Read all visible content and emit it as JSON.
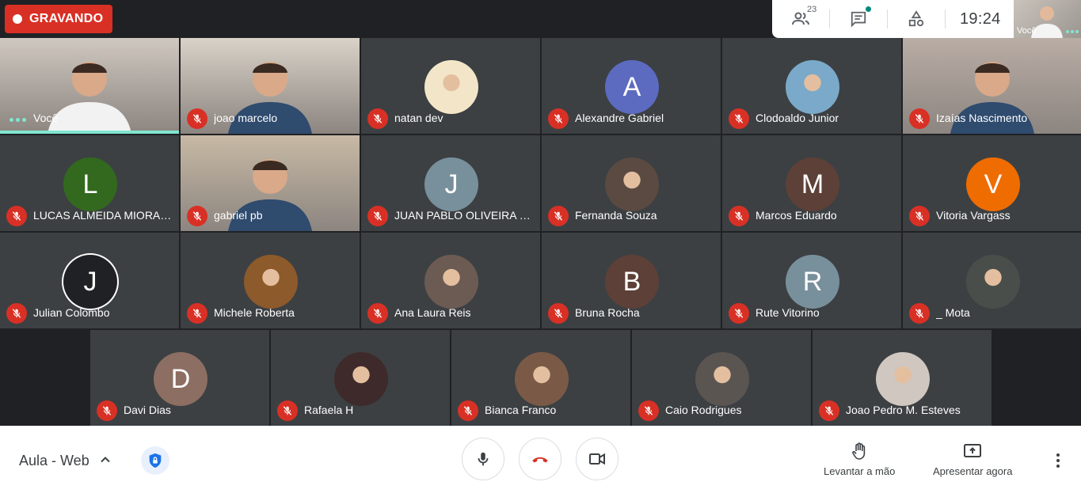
{
  "recording": {
    "label": "GRAVANDO"
  },
  "topbar": {
    "participants_count": "23",
    "clock": "19:24",
    "self_thumb_label": "Você"
  },
  "rows": [
    [
      {
        "name": "Você",
        "kind": "video-self"
      },
      {
        "name": "joao marcelo",
        "kind": "video",
        "bg": "#d8d2c8"
      },
      {
        "name": "natan dev",
        "kind": "photo",
        "color": "#f3e6c8"
      },
      {
        "name": "Alexandre Gabriel",
        "kind": "letter",
        "letter": "A",
        "color": "#5c6bc0"
      },
      {
        "name": "Clodoaldo Junior",
        "kind": "photo",
        "color": "#7aa9c9"
      },
      {
        "name": "Izaías Nascimento",
        "kind": "video",
        "bg": "#b9ada5"
      }
    ],
    [
      {
        "name": "LUCAS ALMEIDA MIORANSI",
        "kind": "letter",
        "letter": "L",
        "color": "#33691e"
      },
      {
        "name": "gabriel pb",
        "kind": "video",
        "bg": "#c7b9a4"
      },
      {
        "name": "JUAN PABLO OLIVEIRA G...",
        "kind": "letter",
        "letter": "J",
        "color": "#78909c"
      },
      {
        "name": "Fernanda Souza",
        "kind": "photo",
        "color": "#5a4a42"
      },
      {
        "name": "Marcos Eduardo",
        "kind": "letter",
        "letter": "M",
        "color": "#5d4037"
      },
      {
        "name": "Vitoria Vargass",
        "kind": "letter",
        "letter": "V",
        "color": "#ef6c00"
      }
    ],
    [
      {
        "name": "Julian Colombo",
        "kind": "letter",
        "letter": "J",
        "color": "#202124",
        "ring": true
      },
      {
        "name": "Michele Roberta",
        "kind": "photo",
        "color": "#8d5a2b"
      },
      {
        "name": "Ana Laura Reis",
        "kind": "photo",
        "color": "#6c5b52"
      },
      {
        "name": "Bruna Rocha",
        "kind": "letter",
        "letter": "B",
        "color": "#5d4037"
      },
      {
        "name": "Rute Vitorino",
        "kind": "letter",
        "letter": "R",
        "color": "#78909c"
      },
      {
        "name": "_ Mota",
        "kind": "photo",
        "color": "#4a4e4a"
      }
    ],
    [
      {
        "name": "Davi Dias",
        "kind": "letter",
        "letter": "D",
        "color": "#8d6e63"
      },
      {
        "name": "Rafaela H",
        "kind": "photo",
        "color": "#3e2a2a"
      },
      {
        "name": "Bianca Franco",
        "kind": "photo",
        "color": "#7a5a46"
      },
      {
        "name": "Caio Rodrigues",
        "kind": "photo",
        "color": "#5b5552"
      },
      {
        "name": "Joao Pedro M. Esteves",
        "kind": "photo",
        "color": "#cfc7c0"
      }
    ]
  ],
  "bottom": {
    "meeting_title": "Aula - Web",
    "raise_hand_label": "Levantar a mão",
    "present_label": "Apresentar agora"
  },
  "colors": {
    "mute_red": "#d93025",
    "speaking_teal": "#81e6cf",
    "tile_bg": "#3c4043",
    "stage_bg": "#202124"
  }
}
